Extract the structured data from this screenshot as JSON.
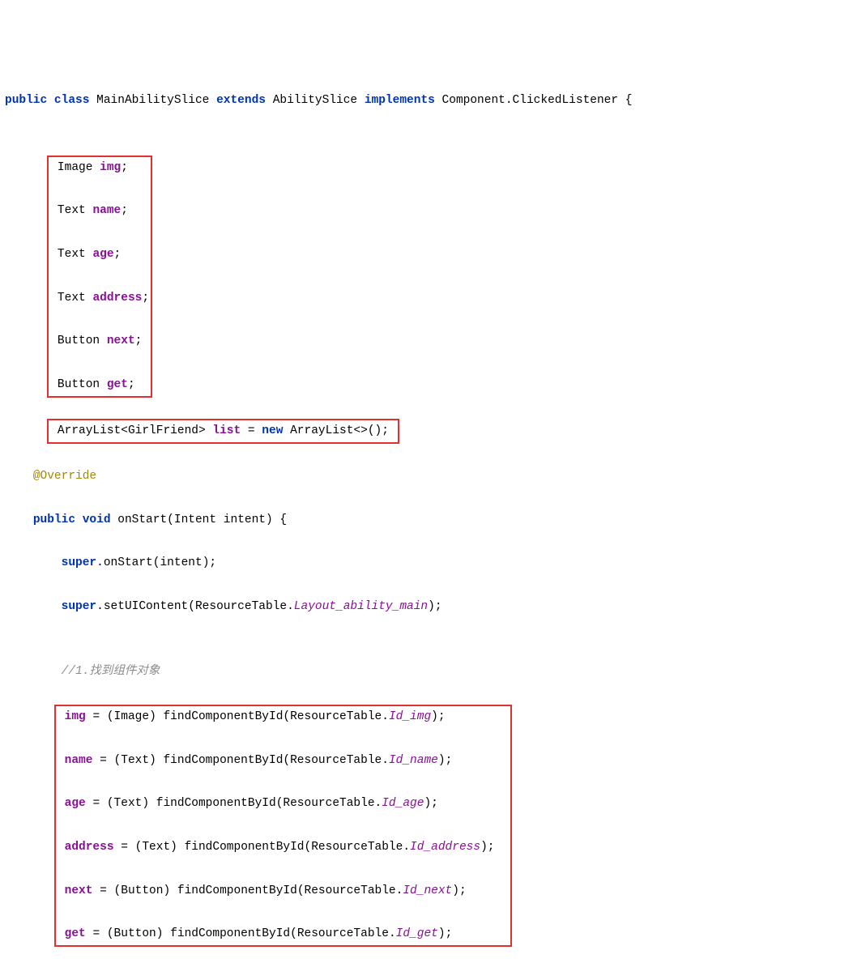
{
  "line1": {
    "public": "public",
    "class": "class",
    "MainAbilitySlice": "MainAbilitySlice",
    "extends": "extends",
    "AbilitySlice": "AbilitySlice",
    "implements": "implements",
    "ComponentClickedListener": "Component.ClickedListener",
    "brace": "{"
  },
  "fields": {
    "Image": "Image",
    "img": "img",
    "Text": "Text",
    "name": "name",
    "age": "age",
    "address": "address",
    "Button": "Button",
    "next": "next",
    "get": "get",
    "semi": ";"
  },
  "listline": {
    "ArrayList": "ArrayList",
    "lt": "<",
    "GirlFriend": "GirlFriend",
    "gt": ">",
    "list": "list",
    "eq": "=",
    "new": "new",
    "ArrayList2": "ArrayList",
    "diamond": "<>",
    "paren": "()",
    "semi": ";"
  },
  "override": "@Override",
  "onstart": {
    "public": "public",
    "void": "void",
    "onStart": "onStart",
    "lparen": "(",
    "Intent": "Intent",
    "intent": "intent",
    "rparen": ")",
    "brace": "{"
  },
  "superOnStart": {
    "super": "super",
    "dot": ".",
    "onStart": "onStart",
    "lparen": "(",
    "intent": "intent",
    "rparen": ")",
    "semi": ";"
  },
  "setUI": {
    "super": "super",
    "dot": ".",
    "setUIContent": "setUIContent",
    "lparen": "(",
    "ResourceTable": "ResourceTable",
    "dot2": ".",
    "Layout_ability_main": "Layout_ability_main",
    "rparen": ")",
    "semi": ";"
  },
  "comment1": "//1.找到组件对象",
  "assign": {
    "eq": "=",
    "lparen": "(",
    "rparen": ")",
    "Image": "Image",
    "Text": "Text",
    "Button": "Button",
    "findComponentById": "findComponentById",
    "ResourceTable": "ResourceTable",
    "dot": ".",
    "semi": ";"
  },
  "ids": {
    "Id_img": "Id_img",
    "Id_name": "Id_name",
    "Id_age": "Id_age",
    "Id_address": "Id_address",
    "Id_next": "Id_next",
    "Id_get": "Id_get"
  },
  "vars": {
    "img": "img",
    "name": "name",
    "age": "age",
    "address": "address",
    "next": "next",
    "get": "get"
  }
}
